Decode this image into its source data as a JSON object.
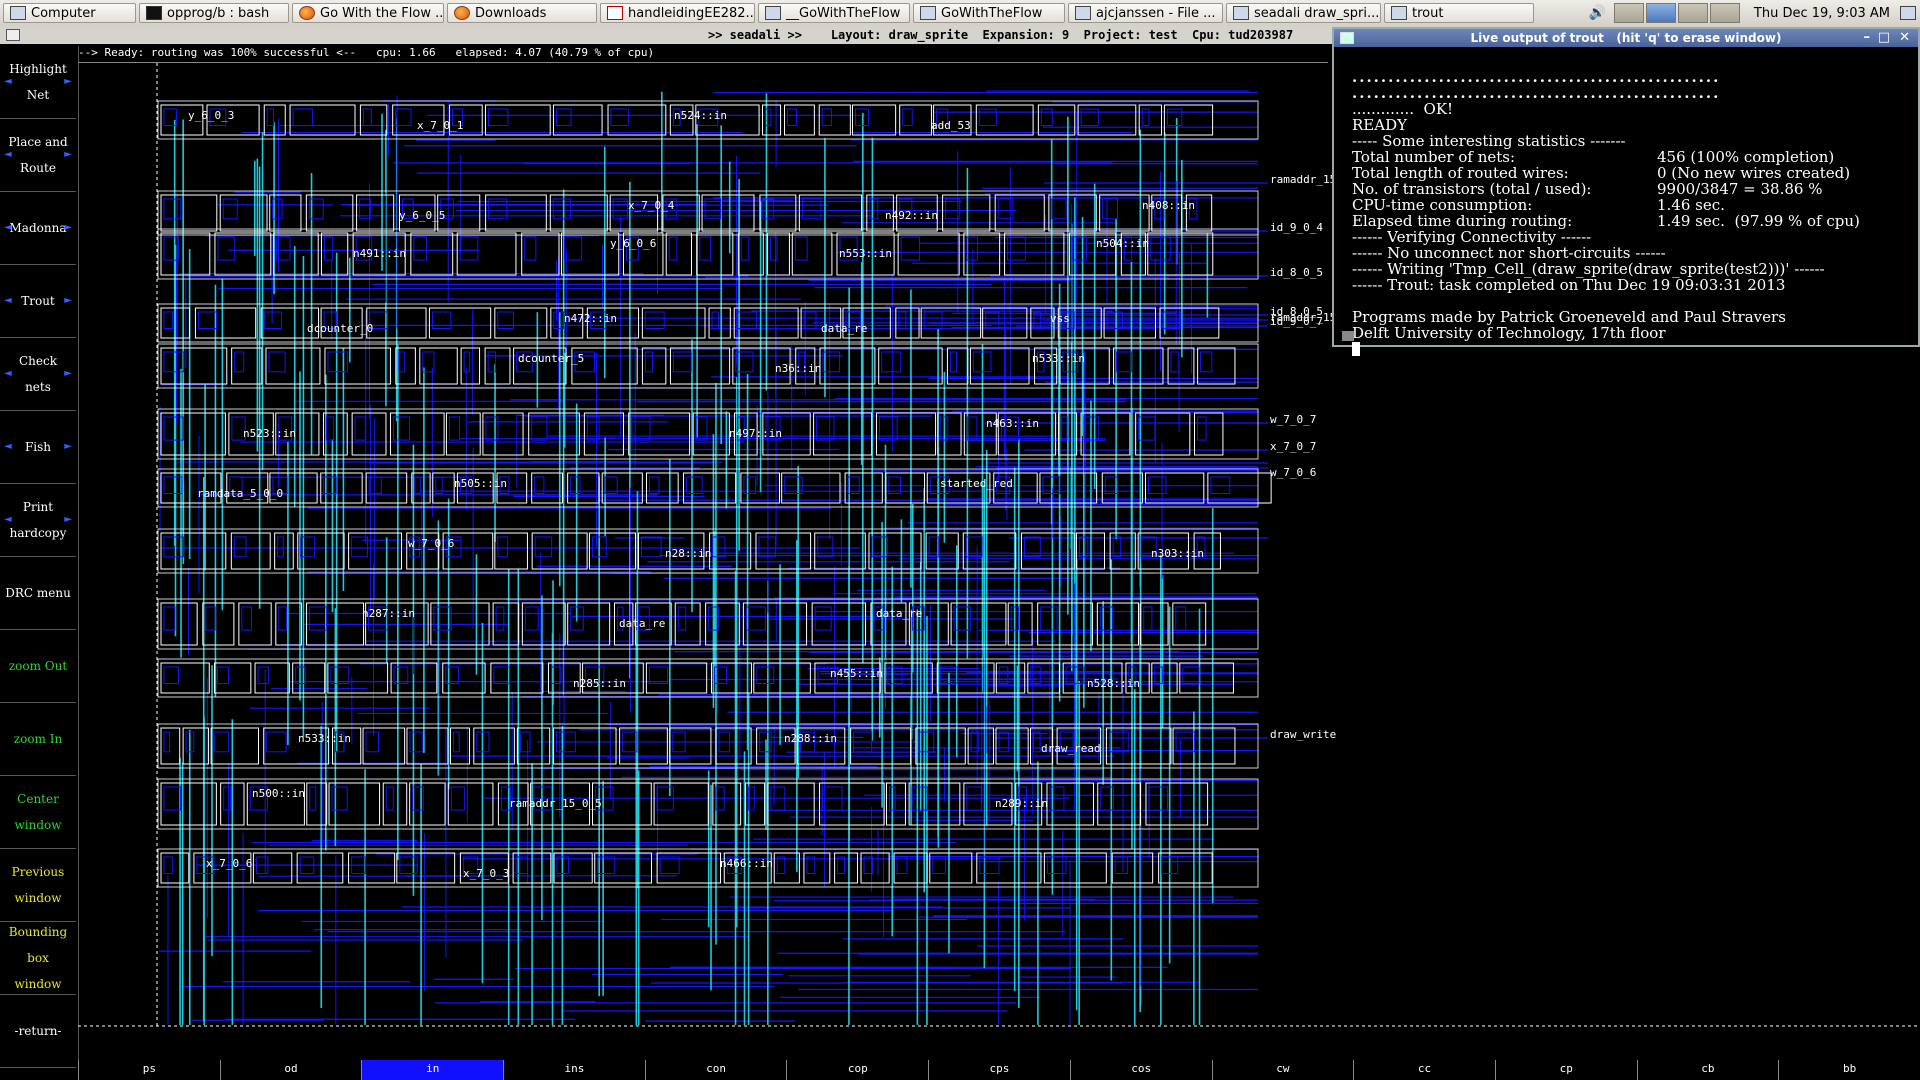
{
  "taskbar": {
    "items": [
      {
        "label": "Computer",
        "icon": "computer-icon"
      },
      {
        "label": "opprog/b : bash",
        "icon": "terminal-icon"
      },
      {
        "label": "Go With the Flow ...",
        "icon": "firefox-icon"
      },
      {
        "label": "Downloads",
        "icon": "firefox-icon"
      },
      {
        "label": "handleidingEE282...",
        "icon": "pdf-icon"
      },
      {
        "label": "__GoWithTheFlow",
        "icon": "window-icon"
      },
      {
        "label": "GoWithTheFlow",
        "icon": "window-icon"
      },
      {
        "label": "ajcjanssen - File ...",
        "icon": "folder-icon"
      },
      {
        "label": "seadali draw_spri...",
        "icon": "window-icon"
      },
      {
        "label": "trout",
        "icon": "window-icon"
      }
    ],
    "clock": "Thu Dec 19,  9:03 AM"
  },
  "window": {
    "title": ">> seadali >>    Layout: draw_sprite  Expansion: 9  Project: test  Cpu: tud203987"
  },
  "status": "--> Ready: routing was 100% successful <--   cpu: 1.66   elapsed: 4.07 (40.79 % of cpu)",
  "menu": {
    "items": [
      {
        "label": "Highlight\nNet",
        "color": "white"
      },
      {
        "label": "Place and\nRoute",
        "color": "white"
      },
      {
        "label": "Madonna",
        "color": "white"
      },
      {
        "label": "Trout",
        "color": "white"
      },
      {
        "label": "Check\nnets",
        "color": "white"
      },
      {
        "label": "Fish",
        "color": "white"
      },
      {
        "label": "Print\nhardcopy",
        "color": "white"
      },
      {
        "label": "DRC menu",
        "color": "white"
      },
      {
        "label": "zoom Out",
        "color": "green"
      },
      {
        "label": "zoom In",
        "color": "green"
      },
      {
        "label": "Center\nwindow",
        "color": "green"
      },
      {
        "label": "Previous\nwindow",
        "color": "yellow"
      },
      {
        "label": "Bounding box\nwindow",
        "color": "yellow"
      },
      {
        "label": "-return-",
        "color": "white"
      }
    ]
  },
  "layers": {
    "items": [
      "ps",
      "od",
      "in",
      "ins",
      "con",
      "cop",
      "cps",
      "cos",
      "cw",
      "cc",
      "cp",
      "cb",
      "bb"
    ],
    "selected": "in"
  },
  "trout": {
    "title": "Live output of trout   (hit 'q' to erase window)",
    "dots1": "...................................................",
    "dots2": "...................................................",
    "ok_line": ".............  OK!",
    "ready": "READY",
    "stats_header": "----- Some interesting statistics -------",
    "stats": [
      {
        "key": "Total number of nets:",
        "value": "456 (100% completion)"
      },
      {
        "key": "Total length of routed wires:",
        "value": "0 (No new wires created)"
      },
      {
        "key": "No. of transistors (total / used):",
        "value": "9900/3847 = 38.86 %"
      },
      {
        "key": "CPU-time consumption:",
        "value": "1.46 sec."
      },
      {
        "key": "Elapsed time during routing:",
        "value": "1.49 sec.  (97.99 % of cpu)"
      }
    ],
    "messages": [
      "------ Verifying Connectivity ------",
      "------ No unconnect nor short-circuits ------",
      "------ Writing 'Tmp_Cell_(draw_sprite(draw_sprite(test2)))' ------",
      "------ Trout: task completed on Thu Dec 19 09:03:31 2013"
    ],
    "credits": [
      "Programs made by Patrick Groeneveld and Paul Stravers",
      "Delft University of Technology, 17th floor"
    ]
  },
  "layout_labels": {
    "port_labels": [
      "ramaddr_15_",
      "id_9_0_4",
      "id_8_0_5",
      "id_8_0_5",
      "ramaddr_15_0_11",
      "id_9_0_7",
      "w_7_0_7",
      "x_7_0_7",
      "w_7_0_6",
      "draw_write"
    ],
    "cell_labels": [
      "y_6_0_3",
      "y_6_0_5",
      "y_6_0_6",
      "data_re",
      "n533::in",
      "n523::in",
      "n505::in",
      "n28::in",
      "data_re",
      "n528::in",
      "n533::in",
      "ramaddr_15_0_5",
      "n466::in",
      "add_53",
      "n408::in",
      "n491::in",
      "n472::in",
      "n36::in",
      "n463::in",
      "ramdata_5_0_0",
      "w_7_0_6",
      "data_re",
      "n455::in",
      "draw_read",
      "n500::in",
      "x_7_0_3",
      "n524::in",
      "n492::in",
      "n504::in",
      "dcounter_0",
      "dcounter_5",
      "n497::in",
      "started_red",
      "n303::in",
      "n287::in",
      "n285::in",
      "n288::in",
      "n289::in",
      "x_7_0_6",
      "x_7_0_1",
      "x_7_0_4",
      "n553::in",
      "vss"
    ]
  },
  "colors": {
    "background": "#000000",
    "wire_blue": "#1414ff",
    "wire_cyan": "#20c8d8",
    "cell_outline": "#ffffff",
    "selected_layer": "#1010ff",
    "menu_green": "#2bd82b",
    "menu_yellow": "#e6e62a"
  }
}
